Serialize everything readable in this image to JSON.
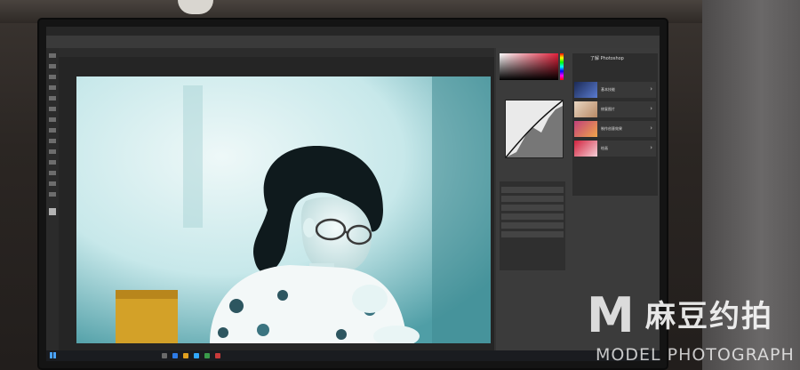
{
  "photoshop": {
    "learn_panel": {
      "title": "了解 Photoshop",
      "items": [
        {
          "label": "基本技能"
        },
        {
          "label": "修复图片"
        },
        {
          "label": "制作创意效果"
        },
        {
          "label": "绘画"
        }
      ]
    }
  },
  "watermark": {
    "logo_letter": "M",
    "chinese": "麻豆约拍",
    "english": "MODEL PHOTOGRAPH"
  },
  "colors": {
    "photo_tone": "#bfe3e6",
    "accent_red": "#e2213b",
    "windows_blue": "#4aa3ff"
  }
}
